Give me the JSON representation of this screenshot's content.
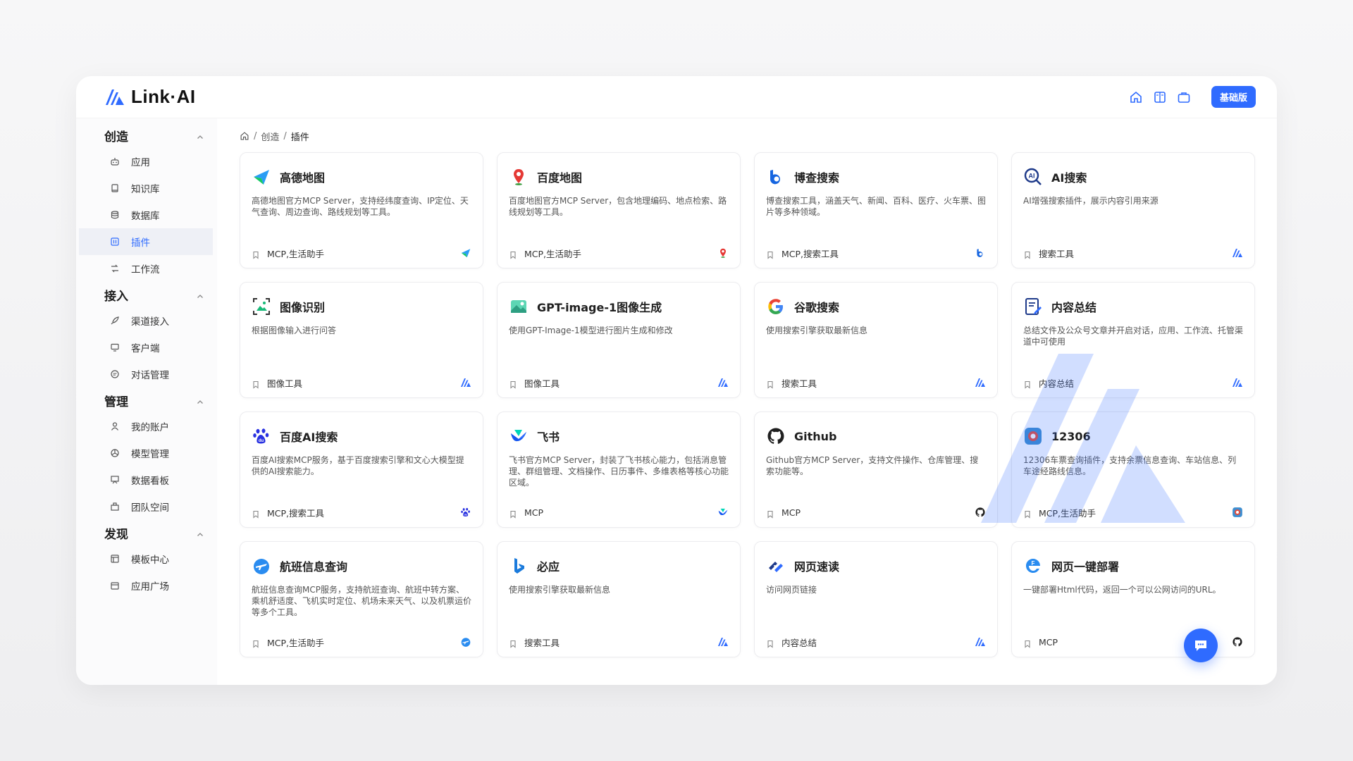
{
  "app": {
    "logo_text": "Link·AI",
    "edition_button": "基础版"
  },
  "breadcrumb": [
    "创造",
    "插件"
  ],
  "sidebar": {
    "sections": [
      {
        "title": "创造",
        "items": [
          {
            "label": "应用",
            "icon": "robot-icon"
          },
          {
            "label": "知识库",
            "icon": "book-icon"
          },
          {
            "label": "数据库",
            "icon": "database-icon"
          },
          {
            "label": "插件",
            "icon": "plugin-icon",
            "active": true
          },
          {
            "label": "工作流",
            "icon": "workflow-icon"
          }
        ]
      },
      {
        "title": "接入",
        "items": [
          {
            "label": "渠道接入",
            "icon": "rocket-icon"
          },
          {
            "label": "客户端",
            "icon": "monitor-icon"
          },
          {
            "label": "对话管理",
            "icon": "chat-icon"
          }
        ]
      },
      {
        "title": "管理",
        "items": [
          {
            "label": "我的账户",
            "icon": "user-icon"
          },
          {
            "label": "模型管理",
            "icon": "model-icon"
          },
          {
            "label": "数据看板",
            "icon": "dashboard-icon"
          },
          {
            "label": "团队空间",
            "icon": "team-icon"
          }
        ]
      },
      {
        "title": "发现",
        "items": [
          {
            "label": "模板中心",
            "icon": "template-icon"
          },
          {
            "label": "应用广场",
            "icon": "store-icon"
          }
        ]
      }
    ]
  },
  "plugins": [
    {
      "title": "高德地图",
      "desc": "高德地图官方MCP Server，支持经纬度查询、IP定位、天气查询、周边查询、路线规划等工具。",
      "tag": "MCP,生活助手",
      "logo": "amap-icon"
    },
    {
      "title": "百度地图",
      "desc": "百度地图官方MCP Server，包含地理编码、地点检索、路线规划等工具。",
      "tag": "MCP,生活助手",
      "logo": "baidu-map-icon"
    },
    {
      "title": "博查搜索",
      "desc": "博查搜索工具，涵盖天气、新闻、百科、医疗、火车票、图片等多种领域。",
      "tag": "MCP,搜索工具",
      "logo": "bocha-icon"
    },
    {
      "title": "AI搜索",
      "desc": "AI增强搜索插件，展示内容引用来源",
      "tag": "搜索工具",
      "logo": "ai-search-icon"
    },
    {
      "title": "图像识别",
      "desc": "根据图像输入进行问答",
      "tag": "图像工具",
      "logo": "image-recognition-icon"
    },
    {
      "title": "GPT-image-1图像生成",
      "desc": "使用GPT-Image-1模型进行图片生成和修改",
      "tag": "图像工具",
      "logo": "image-gen-icon"
    },
    {
      "title": "谷歌搜索",
      "desc": "使用搜索引擎获取最新信息",
      "tag": "搜索工具",
      "logo": "google-icon"
    },
    {
      "title": "内容总结",
      "desc": "总结文件及公众号文章并开启对话，应用、工作流、托管渠道中可使用",
      "tag": "内容总结",
      "logo": "summary-icon"
    },
    {
      "title": "百度AI搜索",
      "desc": "百度AI搜索MCP服务，基于百度搜索引擎和文心大模型提供的AI搜索能力。",
      "tag": "MCP,搜索工具",
      "logo": "baidu-icon"
    },
    {
      "title": "飞书",
      "desc": "飞书官方MCP Server，封装了飞书核心能力，包括消息管理、群组管理、文档操作、日历事件、多维表格等核心功能区域。",
      "tag": "MCP",
      "logo": "feishu-icon"
    },
    {
      "title": "Github",
      "desc": "Github官方MCP Server，支持文件操作、仓库管理、搜索功能等。",
      "tag": "MCP",
      "logo": "github-icon"
    },
    {
      "title": "12306",
      "desc": "12306车票查询插件，支持余票信息查询、车站信息、列车途经路线信息。",
      "tag": "MCP,生活助手",
      "logo": "train-icon"
    },
    {
      "title": "航班信息查询",
      "desc": "航班信息查询MCP服务，支持航班查询、航班中转方案、乘机舒适度、飞机实时定位、机场未来天气、以及机票运价等多个工具。",
      "tag": "MCP,生活助手",
      "logo": "flight-icon"
    },
    {
      "title": "必应",
      "desc": "使用搜索引擎获取最新信息",
      "tag": "搜索工具",
      "logo": "bing-icon"
    },
    {
      "title": "网页速读",
      "desc": "访问网页链接",
      "tag": "内容总结",
      "logo": "web-read-icon"
    },
    {
      "title": "网页一键部署",
      "desc": "一键部署Html代码，返回一个可以公网访问的URL。",
      "tag": "MCP",
      "logo": "deploy-icon"
    }
  ],
  "foot_logos": [
    "amap-icon",
    "baidu-map-icon",
    "bocha-icon",
    "linkai-icon",
    "linkai-icon",
    "linkai-icon",
    "linkai-icon",
    "linkai-icon",
    "baidu-icon",
    "feishu-icon",
    "github-icon",
    "train-icon",
    "flight-icon",
    "linkai-icon",
    "linkai-icon",
    "github-icon"
  ],
  "colors": {
    "accent": "#2f6bff",
    "active_bg": "#eef0f6"
  }
}
